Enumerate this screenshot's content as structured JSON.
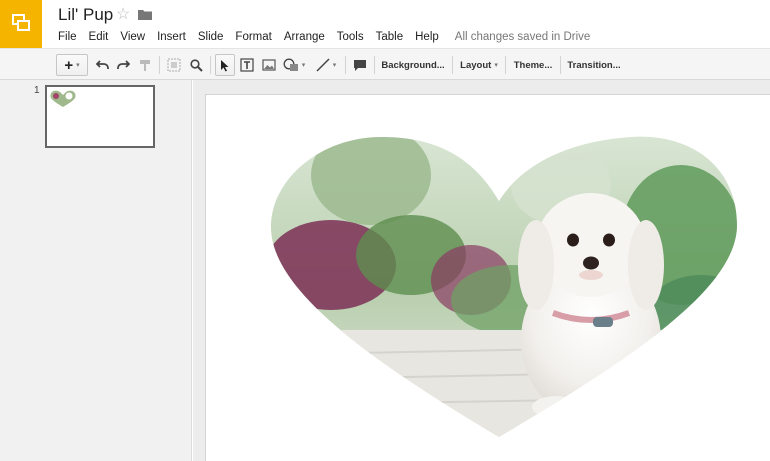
{
  "app": {
    "document_title": "Lil' Pup",
    "save_status": "All changes saved in Drive",
    "brand_color": "#f4b400"
  },
  "menu": [
    "File",
    "Edit",
    "View",
    "Insert",
    "Slide",
    "Format",
    "Arrange",
    "Tools",
    "Table",
    "Help"
  ],
  "toolbar": {
    "background_label": "Background...",
    "layout_label": "Layout",
    "theme_label": "Theme...",
    "transition_label": "Transition..."
  },
  "filmstrip": {
    "slides": [
      {
        "number": "1"
      }
    ]
  },
  "slide": {
    "image": "heart-shaped photo of a white fluffy puppy"
  }
}
